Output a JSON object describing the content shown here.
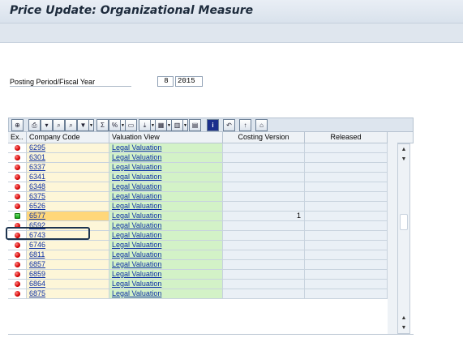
{
  "window": {
    "title": "Price Update: Organizational Measure"
  },
  "selection": {
    "period_label": "Posting Period/Fiscal Year",
    "period": "8",
    "year": "2015"
  },
  "toolbar": {
    "buttons": [
      {
        "icon": "details-icon"
      },
      {
        "icon": "print-icon"
      },
      {
        "icon": "filter-down-icon"
      },
      {
        "icon": "find-icon"
      },
      {
        "icon": "find-next-icon"
      },
      {
        "icon": "set-filter-icon"
      },
      {
        "icon": "sum-icon"
      },
      {
        "icon": "subtotal-icon"
      },
      {
        "icon": "print-preview-icon"
      },
      {
        "icon": "export-icon"
      },
      {
        "icon": "spreadsheet-icon"
      },
      {
        "icon": "layout-icon"
      },
      {
        "icon": "select-layout-icon"
      },
      {
        "icon": "info-icon"
      },
      {
        "icon": "navigate-icon"
      },
      {
        "icon": "upload-icon"
      },
      {
        "icon": "download-icon"
      }
    ]
  },
  "table": {
    "headers": {
      "ex": "Ex..",
      "company_code": "Company Code",
      "valuation_view": "Valuation View",
      "costing_version": "Costing Version",
      "released": "Released"
    },
    "rows": [
      {
        "status": "red",
        "company_code": "6295",
        "valuation_view": "Legal Valuation",
        "costing_version": "",
        "released": ""
      },
      {
        "status": "red",
        "company_code": "6301",
        "valuation_view": "Legal Valuation",
        "costing_version": "",
        "released": ""
      },
      {
        "status": "red",
        "company_code": "6337",
        "valuation_view": "Legal Valuation",
        "costing_version": "",
        "released": ""
      },
      {
        "status": "red",
        "company_code": "6341",
        "valuation_view": "Legal Valuation",
        "costing_version": "",
        "released": ""
      },
      {
        "status": "red",
        "company_code": "6348",
        "valuation_view": "Legal Valuation",
        "costing_version": "",
        "released": ""
      },
      {
        "status": "red",
        "company_code": "6375",
        "valuation_view": "Legal Valuation",
        "costing_version": "",
        "released": ""
      },
      {
        "status": "red",
        "company_code": "6526",
        "valuation_view": "Legal Valuation",
        "costing_version": "",
        "released": ""
      },
      {
        "status": "green",
        "company_code": "6577",
        "valuation_view": "Legal Valuation",
        "costing_version": "1",
        "released": ""
      },
      {
        "status": "red",
        "company_code": "6592",
        "valuation_view": "Legal Valuation",
        "costing_version": "",
        "released": ""
      },
      {
        "status": "red",
        "company_code": "6743",
        "valuation_view": "Legal Valuation",
        "costing_version": "",
        "released": ""
      },
      {
        "status": "red",
        "company_code": "6746",
        "valuation_view": "Legal Valuation",
        "costing_version": "",
        "released": ""
      },
      {
        "status": "red",
        "company_code": "6811",
        "valuation_view": "Legal Valuation",
        "costing_version": "",
        "released": ""
      },
      {
        "status": "red",
        "company_code": "6857",
        "valuation_view": "Legal Valuation",
        "costing_version": "",
        "released": ""
      },
      {
        "status": "red",
        "company_code": "6859",
        "valuation_view": "Legal Valuation",
        "costing_version": "",
        "released": ""
      },
      {
        "status": "red",
        "company_code": "6864",
        "valuation_view": "Legal Valuation",
        "costing_version": "",
        "released": ""
      },
      {
        "status": "red",
        "company_code": "6875",
        "valuation_view": "Legal Valuation",
        "costing_version": "",
        "released": ""
      }
    ]
  },
  "colors": {
    "status_red": "#d40000",
    "status_green": "#14a514",
    "valuation_bg": "#d3f2c7",
    "highlight": "#1e3550"
  }
}
